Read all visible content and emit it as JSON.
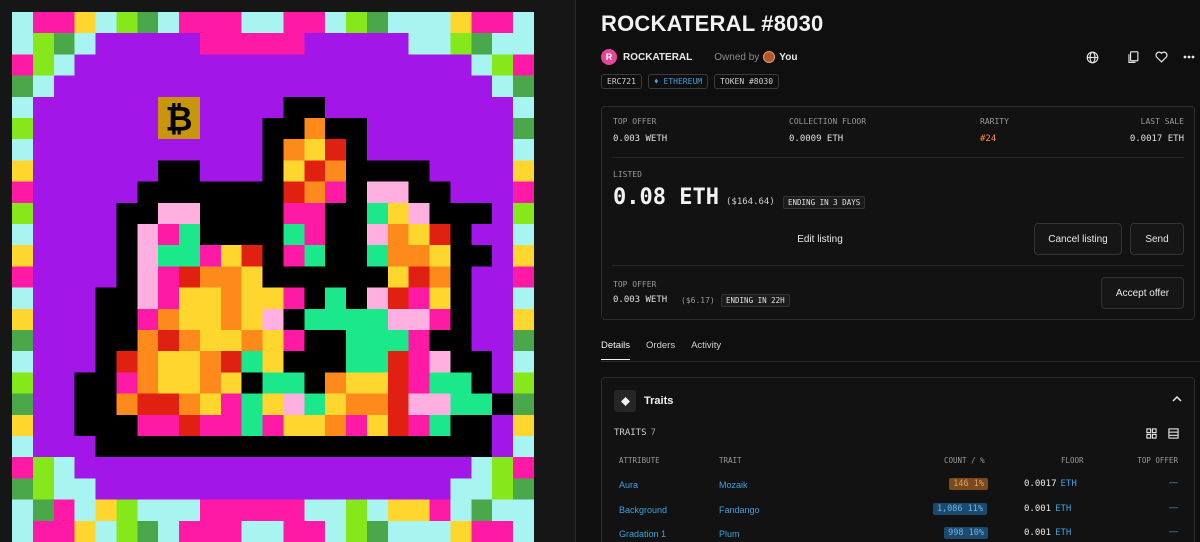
{
  "nft": {
    "title": "ROCKATERAL #8030",
    "collection_logo_letter": "R",
    "collection_name": "ROCKATERAL",
    "owned_by_label": "Owned by",
    "owner_name": "You",
    "badges": [
      "ERC721",
      "♦ ETHEREUM",
      "TOKEN #8030"
    ]
  },
  "top_icons": [
    "globe-icon",
    "copy-icon",
    "heart-icon",
    "more-icon"
  ],
  "stats": [
    {
      "label": "TOP OFFER",
      "value": "0.003 WETH"
    },
    {
      "label": "COLLECTION FLOOR",
      "value": "0.0009 ETH"
    },
    {
      "label": "RARITY",
      "value": "#24"
    },
    {
      "label": "LAST SALE",
      "value": "0.0017 ETH"
    }
  ],
  "listing": {
    "label": "LISTED",
    "price": "0.08 ETH",
    "usd": "($164.64)",
    "ending": "ENDING IN 3 DAYS",
    "edit_label": "Edit listing",
    "cancel_label": "Cancel listing",
    "send_label": "Send"
  },
  "offer": {
    "label": "TOP OFFER",
    "value": "0.003 WETH",
    "usd": "($6.17)",
    "ending": "ENDING IN 22H",
    "accept_label": "Accept offer"
  },
  "tabs": [
    "Details",
    "Orders",
    "Activity"
  ],
  "traits": {
    "title": "Traits",
    "count_label": "TRAITS",
    "count": "7",
    "headers": [
      "ATTRIBUTE",
      "TRAIT",
      "COUNT / %",
      "FLOOR",
      "TOP OFFER"
    ],
    "rows": [
      {
        "attribute": "Aura",
        "trait": "Mozaik",
        "count": "146 1%",
        "floor": "0.0017",
        "unit": "ETH",
        "top_offer": "—",
        "pill_color": "#7a4a1c",
        "pill_text_color": "#e0a060"
      },
      {
        "attribute": "Background",
        "trait": "Fandango",
        "count": "1,086 11%",
        "floor": "0.001",
        "unit": "ETH",
        "top_offer": "—",
        "pill_color": "#1c4a6e",
        "pill_text_color": "#6ab4e8"
      },
      {
        "attribute": "Gradation 1",
        "trait": "Plum",
        "count": "998 10%",
        "floor": "0.001",
        "unit": "ETH",
        "top_offer": "—",
        "pill_color": "#1c4a6e",
        "pill_text_color": "#6ab4e8"
      }
    ]
  }
}
